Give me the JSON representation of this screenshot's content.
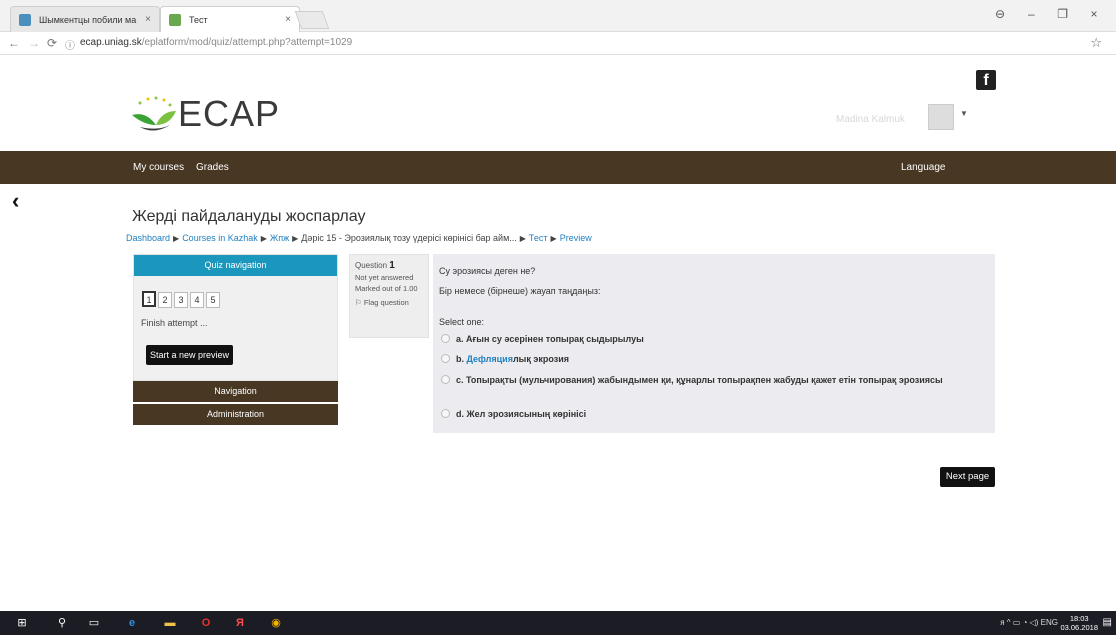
{
  "browser": {
    "tabs": [
      {
        "title": "Шымкентцы побили ма",
        "close": "×"
      },
      {
        "title": "Тест",
        "close": "×"
      }
    ],
    "window_controls": [
      "⊖",
      "–",
      "❐",
      "×"
    ],
    "url_host": "ecap.uniag.sk",
    "url_path": "/eplatform/mod/quiz/attempt.php?attempt=1029"
  },
  "header": {
    "logo_text": "ECAP",
    "user_name": "Madina Kalmuk",
    "facebook_label": "f"
  },
  "menubar": {
    "my_courses": "My courses",
    "grades": "Grades",
    "language": "Language"
  },
  "page": {
    "title": "Жерді пайдалануды жоспарлау",
    "breadcrumb": [
      "Dashboard",
      "Courses in Kazhak",
      "Жпж",
      "Дәріс 15 - Эрозиялық тозу үдерісі көрінісі бар айм...",
      "Тест",
      "Preview"
    ]
  },
  "quiz_nav": {
    "title": "Quiz navigation",
    "questions": [
      "1",
      "2",
      "3",
      "4",
      "5"
    ],
    "finish": "Finish attempt ...",
    "new_preview": "Start a new preview"
  },
  "blocks": {
    "navigation": "Navigation",
    "administration": "Administration"
  },
  "question_info": {
    "label": "Question",
    "number": "1",
    "state": "Not yet answered",
    "marked": "Marked out of 1.00",
    "flag": "Flag question"
  },
  "question": {
    "text": "Су эрозиясы деген не?",
    "prompt": "Бір немесе (бірнеше) жауап таңдаңыз:",
    "select_one": "Select one:",
    "answers": {
      "a": "a. Ағын су әсерінен топырақ сыдырылуы",
      "b_prefix": "b. ",
      "b_link": "Дефляция",
      "b_suffix": "лық экрозия",
      "c": "c. Топырақты (мульчирования) жабындымен қи, құнарлы топырақпен  жабуды қажет етін  топырақ эрозиясы",
      "d": "d. Жел эрозиясының көрінісі"
    }
  },
  "next_page": "Next page",
  "taskbar": {
    "tray": "ENG",
    "time": "18:03",
    "date": "03.06.2018"
  }
}
